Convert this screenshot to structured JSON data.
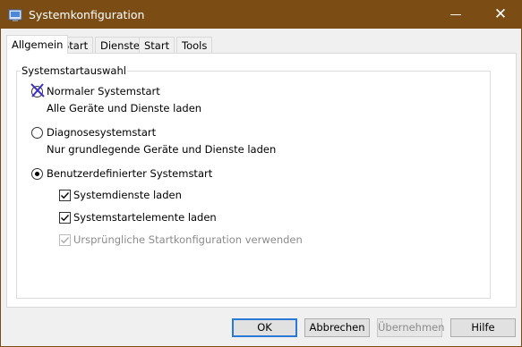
{
  "window": {
    "title": "Systemkonfiguration",
    "minimize_glyph": "—",
    "close_glyph": "✕"
  },
  "tabs": [
    {
      "label": "Allgemein",
      "active": true
    },
    {
      "label": "Start"
    },
    {
      "label": "Dienste"
    },
    {
      "label": "Start"
    },
    {
      "label": "Tools"
    }
  ],
  "group": {
    "title": "Systemstartauswahl"
  },
  "options": {
    "normal": {
      "label": "Normaler Systemstart",
      "description": "Alle Geräte und Dienste laden"
    },
    "diagnostic": {
      "label": "Diagnosesystemstart",
      "description": "Nur grundlegende Geräte und Dienste laden"
    },
    "custom": {
      "label": "Benutzerdefinierter Systemstart",
      "selected": true
    }
  },
  "checks": {
    "load_services": {
      "label": "Systemdienste laden",
      "checked": true
    },
    "load_startup": {
      "label": "Systemstartelemente laden",
      "checked": true
    },
    "original_config": {
      "label": "Ursprüngliche Startkonfiguration verwenden",
      "checked": true,
      "disabled": true
    }
  },
  "buttons": {
    "ok": "OK",
    "cancel": "Abbrechen",
    "apply": "Übernehmen",
    "help": "Hilfe"
  },
  "colors": {
    "titlebar": "#7b4d14",
    "accent": "#2a79d6",
    "annotation": "#3b2fc9"
  },
  "icons": {
    "app": "msconfig-icon",
    "annotation": "cross-mark-icon"
  }
}
